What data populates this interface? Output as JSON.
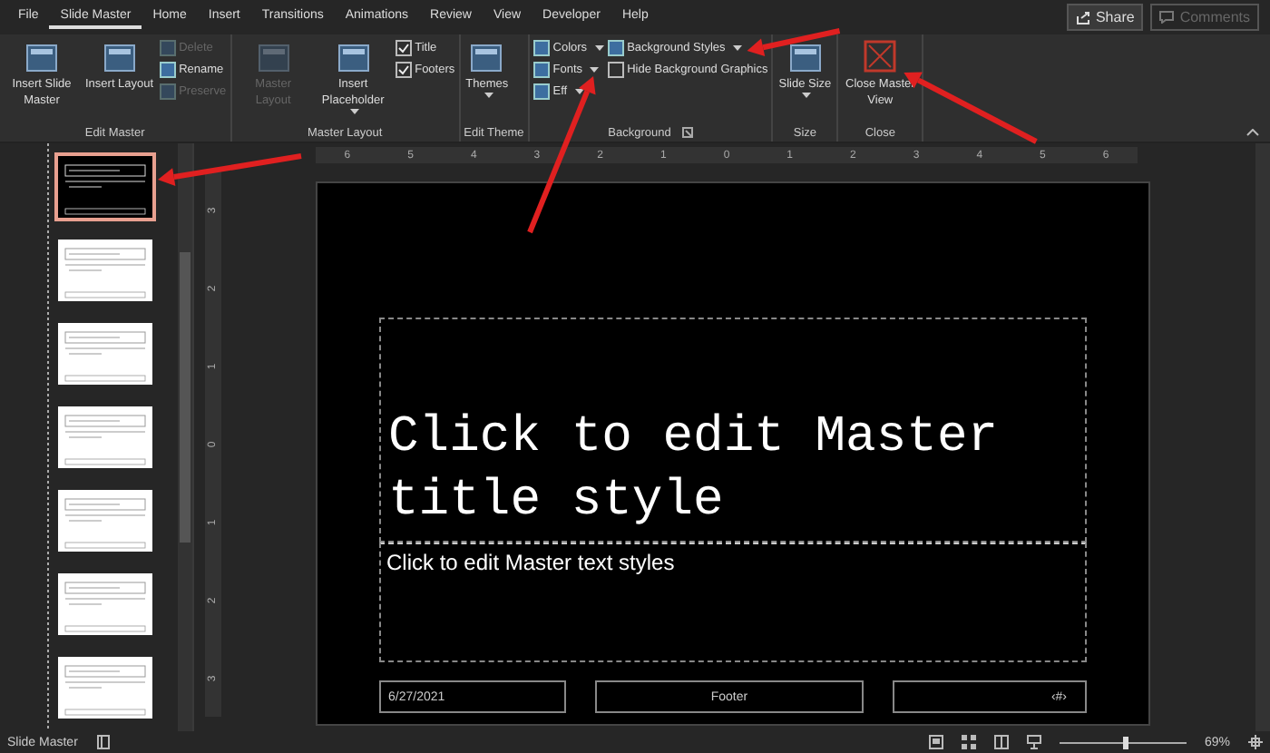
{
  "tabs": [
    {
      "label": "File",
      "selected": false
    },
    {
      "label": "Slide Master",
      "selected": true
    },
    {
      "label": "Home",
      "selected": false
    },
    {
      "label": "Insert",
      "selected": false
    },
    {
      "label": "Transitions",
      "selected": false
    },
    {
      "label": "Animations",
      "selected": false
    },
    {
      "label": "Review",
      "selected": false
    },
    {
      "label": "View",
      "selected": false
    },
    {
      "label": "Developer",
      "selected": false
    },
    {
      "label": "Help",
      "selected": false
    }
  ],
  "share": {
    "label": "Share"
  },
  "comments": {
    "label": "Comments",
    "disabled": true
  },
  "ribbon": [
    {
      "label": "Edit Master",
      "items": [
        {
          "kind": "big",
          "label": "Insert Slide Master",
          "disabled": false
        },
        {
          "kind": "big",
          "label": "Insert Layout",
          "disabled": false
        },
        {
          "kind": "small",
          "label": "Delete",
          "disabled": true
        },
        {
          "kind": "small",
          "label": "Rename",
          "disabled": false
        },
        {
          "kind": "small",
          "label": "Preserve",
          "disabled": true
        }
      ]
    },
    {
      "label": "Master Layout",
      "items": [
        {
          "kind": "big",
          "label": "Master Layout",
          "disabled": true
        },
        {
          "kind": "big",
          "label": "Insert Placeholder",
          "disabled": false,
          "dropdown": true
        },
        {
          "kind": "check",
          "label": "Title",
          "checked": true
        },
        {
          "kind": "check",
          "label": "Footers",
          "checked": true
        }
      ]
    },
    {
      "label": "Edit Theme",
      "items": [
        {
          "kind": "big",
          "label": "Themes",
          "disabled": false,
          "dropdown": true
        }
      ]
    },
    {
      "label": "Background",
      "launcher": true,
      "items": [
        {
          "kind": "small",
          "label": "Colors",
          "disabled": false,
          "dropdown": true
        },
        {
          "kind": "small",
          "label": "Fonts",
          "disabled": false,
          "dropdown": true
        },
        {
          "kind": "small",
          "label": "Eff",
          "disabled": false,
          "dropdown": true
        },
        {
          "kind": "small",
          "label": "Background Styles",
          "disabled": false,
          "dropdown": true
        },
        {
          "kind": "check",
          "label": "Hide Background Graphics",
          "checked": false
        }
      ]
    },
    {
      "label": "Size",
      "items": [
        {
          "kind": "big",
          "label": "Slide Size",
          "disabled": false,
          "dropdown": true
        }
      ]
    },
    {
      "label": "Close",
      "items": [
        {
          "kind": "close",
          "label": "Close Master View",
          "disabled": false
        }
      ]
    }
  ],
  "hruler": [
    "6",
    "5",
    "4",
    "3",
    "2",
    "1",
    "0",
    "1",
    "2",
    "3",
    "4",
    "5",
    "6"
  ],
  "vruler": [
    "3",
    "2",
    "1",
    "0",
    "1",
    "2",
    "3"
  ],
  "thumbnails": [
    {
      "kind": "dark",
      "selected": true
    },
    {
      "kind": "light",
      "selected": false
    },
    {
      "kind": "light",
      "selected": false
    },
    {
      "kind": "light",
      "selected": false
    },
    {
      "kind": "light",
      "selected": false
    },
    {
      "kind": "light",
      "selected": false
    },
    {
      "kind": "light",
      "selected": false
    }
  ],
  "slide": {
    "title": "Click to edit Master title style",
    "body": "Click to edit Master text styles",
    "date": "6/27/2021",
    "footer": "Footer",
    "number": "‹#›"
  },
  "status_bar": {
    "view": "Slide Master",
    "zoom": "69%",
    "zoom_slider": {
      "level": 0.5
    }
  }
}
